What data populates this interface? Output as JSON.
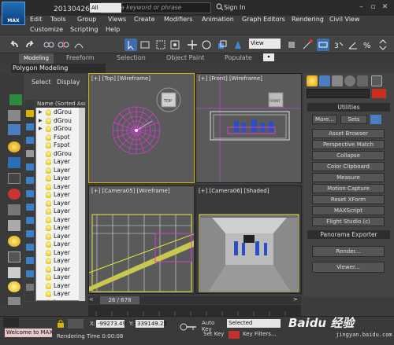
{
  "app": {
    "logo_text": "MAX",
    "window_title": "20130426平...",
    "search_placeholder": "Type a keyword or phrase",
    "sign_in": "Sign In",
    "window_controls": [
      "minimize-icon",
      "restore-icon",
      "close-icon"
    ]
  },
  "menu": {
    "row1": [
      "Edit",
      "Tools",
      "Group",
      "Views",
      "Create",
      "Modifiers",
      "Animation",
      "Graph Editors",
      "Rendering",
      "Civil View"
    ],
    "row2": [
      "Customize",
      "Scripting",
      "Help"
    ]
  },
  "toolbar": {
    "selection_filter": "All",
    "reference_coord": "View"
  },
  "ribbon": {
    "tabs": [
      "Modeling",
      "Freeform",
      "Selection",
      "Object Paint",
      "Populate"
    ],
    "active_tab": "Modeling",
    "panel_label": "Polygon Modeling"
  },
  "explorer": {
    "tab_select": "Select",
    "tab_display": "Display",
    "column_header": "Name (Sorted Asc",
    "rows": [
      "dGrou",
      "dGrou",
      "dGrou",
      "Fspot",
      "Fspot",
      "dGrou",
      "Layer",
      "Layer",
      "Layer",
      "Layer",
      "Layer",
      "Layer",
      "Layer",
      "Layer",
      "Layer",
      "Layer",
      "Layer",
      "Layer",
      "Layer",
      "Layer",
      "Layer",
      "Layer",
      "Layer",
      "Layer"
    ]
  },
  "viewports": {
    "top_label": "[+] [Top] [Wireframe]",
    "front_label": "[+] [Front] [Wireframe]",
    "cam05_label": "[+] [Camera05] [Wireframe]",
    "cam06_label": "[+] [Camera06] [Shaded]",
    "viewcube_top": "TOP",
    "viewcube_front": "FRONT"
  },
  "command_panel": {
    "utilities_title": "Utilities",
    "more_button": "More...",
    "sets_button": "Sets",
    "utility_buttons": [
      "Asset Browser",
      "Perspective Match",
      "Collapse",
      "Color Clipboard",
      "Measure",
      "Motion Capture",
      "Reset XForm",
      "MAXScript",
      "Flight Studio (c)"
    ],
    "panorama_title": "Panorama Exporter",
    "render_button": "Render...",
    "viewer_button": "Viewer...",
    "object_color": "#c9301f"
  },
  "timeline": {
    "frame_counter": "26 / 678"
  },
  "status": {
    "maxscript_text": "Welcome to MAX:",
    "render_time": "Rendering Time  0:00:08",
    "x_label": "X:",
    "x_value": "-99273.49",
    "y_label": "Y:",
    "y_value": "339149.23",
    "auto_key": "Auto Key",
    "selected_dropdown": "Selected",
    "set_key": "Set Key",
    "key_filters": "Key Filters..."
  },
  "watermark": {
    "main": "Baidu 经验",
    "sub": "jingyan.baidu.com"
  }
}
